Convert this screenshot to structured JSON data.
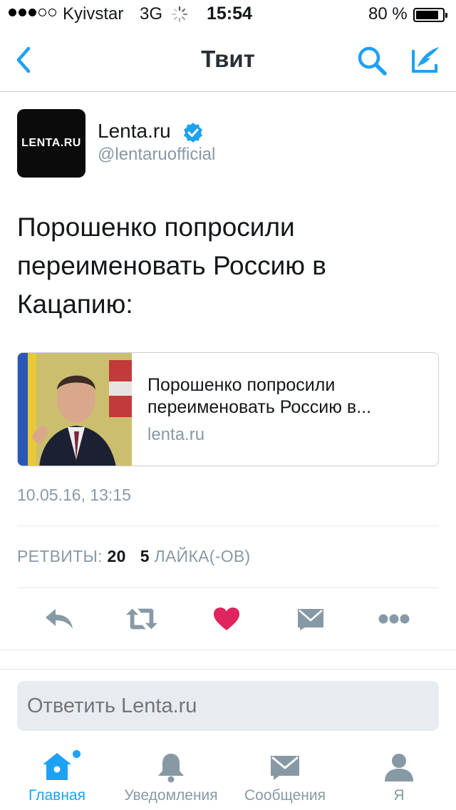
{
  "status_bar": {
    "carrier": "Kyivstar",
    "network": "3G",
    "time": "15:54",
    "battery": "80 %",
    "battery_level": 0.8,
    "signal_bars_filled": 3,
    "signal_bars_total": 5
  },
  "nav": {
    "title": "Твит",
    "back_icon": "chevron-left-icon",
    "search_icon": "search-icon",
    "compose_icon": "compose-icon"
  },
  "tweet": {
    "author_name": "Lenta.ru",
    "author_handle": "@lentaruofficial",
    "avatar_text": "LENTA.RU",
    "verified": true,
    "text": "Порошенко попросили переименовать Россию в Кацапию:",
    "card": {
      "title": "Порошенко попросили переименовать Россию в...",
      "domain": "lenta.ru"
    },
    "timestamp": "10.05.16, 13:15",
    "retweets_label": "РЕТВИТЫ:",
    "retweets_count": "20",
    "likes_count": "5",
    "likes_label": "ЛАЙКА(-ОВ)"
  },
  "actions": {
    "reply": "reply-icon",
    "retweet": "retweet-icon",
    "like": "heart-icon",
    "dm": "envelope-icon",
    "more": "more-icon"
  },
  "reply": {
    "placeholder": "Ответить Lenta.ru"
  },
  "tabs": [
    {
      "label": "Главная",
      "icon": "home-icon",
      "active": true
    },
    {
      "label": "Уведомления",
      "icon": "bell-icon",
      "active": false
    },
    {
      "label": "Сообщения",
      "icon": "envelope-icon",
      "active": false
    },
    {
      "label": "Я",
      "icon": "person-icon",
      "active": false
    }
  ],
  "colors": {
    "accent": "#1da1f2",
    "like": "#e0245e",
    "muted": "#8899a6",
    "icon_gray": "#8899a6"
  }
}
